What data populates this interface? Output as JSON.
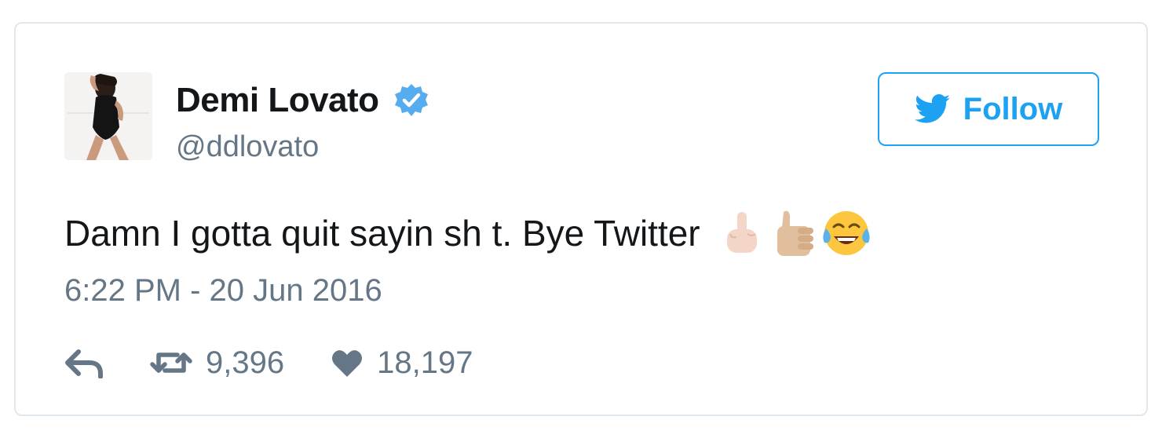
{
  "user": {
    "display_name": "Demi Lovato",
    "handle": "@ddlovato",
    "verified": true,
    "avatar_icon": "profile-photo"
  },
  "follow_button": {
    "label": "Follow",
    "icon": "twitter-bird-icon"
  },
  "tweet": {
    "text": "Damn I gotta quit sayin sh t. Bye Twitter",
    "emojis": [
      "middle-finger-emoji",
      "thumbs-up-emoji",
      "tears-of-joy-emoji"
    ],
    "timestamp": "6:22 PM - 20 Jun 2016"
  },
  "actions": {
    "reply_icon": "reply-icon",
    "retweet_icon": "retweet-icon",
    "retweet_count": "9,396",
    "like_icon": "heart-icon",
    "like_count": "18,197"
  },
  "colors": {
    "brand_blue": "#1da1f2",
    "verified_blue": "#55acee",
    "text_dark": "#14171a",
    "text_muted": "#657786",
    "border": "#e1e8ed"
  }
}
